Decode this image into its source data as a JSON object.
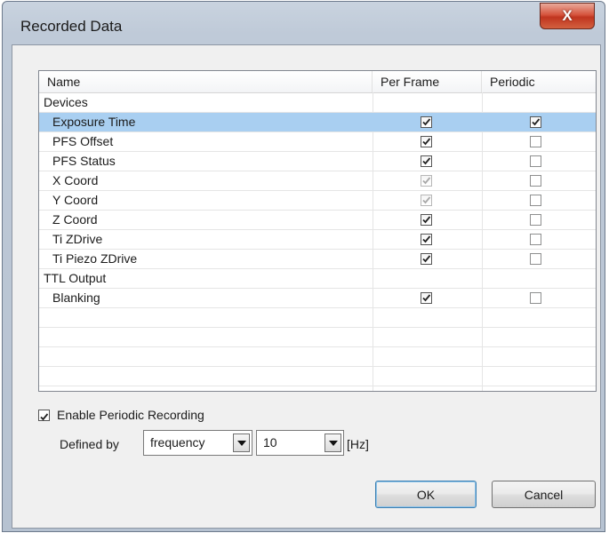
{
  "window": {
    "title": "Recorded Data",
    "close_label": "X"
  },
  "table": {
    "columns": [
      "Name",
      "Per Frame",
      "Periodic"
    ],
    "rows": [
      {
        "name": "Devices",
        "indent": 0,
        "group": true
      },
      {
        "name": "Exposure Time",
        "indent": 1,
        "per_frame": "checked",
        "periodic": "checked",
        "selected": true
      },
      {
        "name": "PFS Offset",
        "indent": 1,
        "per_frame": "checked",
        "periodic": "unchecked"
      },
      {
        "name": "PFS Status",
        "indent": 1,
        "per_frame": "checked",
        "periodic": "unchecked"
      },
      {
        "name": "X Coord",
        "indent": 1,
        "per_frame": "checked-disabled",
        "periodic": "unchecked"
      },
      {
        "name": "Y Coord",
        "indent": 1,
        "per_frame": "checked-disabled",
        "periodic": "unchecked"
      },
      {
        "name": "Z Coord",
        "indent": 1,
        "per_frame": "checked",
        "periodic": "unchecked"
      },
      {
        "name": "Ti ZDrive",
        "indent": 1,
        "per_frame": "checked",
        "periodic": "unchecked"
      },
      {
        "name": "Ti Piezo ZDrive",
        "indent": 1,
        "per_frame": "checked",
        "periodic": "unchecked"
      },
      {
        "name": "TTL Output",
        "indent": 0,
        "group": true
      },
      {
        "name": "Blanking",
        "indent": 1,
        "per_frame": "checked",
        "periodic": "unchecked"
      },
      {
        "name": "",
        "indent": 0,
        "group": true
      },
      {
        "name": "",
        "indent": 0,
        "group": true
      },
      {
        "name": "",
        "indent": 0,
        "group": true
      },
      {
        "name": "",
        "indent": 0,
        "group": true
      }
    ]
  },
  "periodic": {
    "enable_label": "Enable Periodic Recording",
    "enabled": true,
    "defined_by_label": "Defined by",
    "mode_value": "frequency",
    "rate_value": "10",
    "unit": "[Hz]"
  },
  "buttons": {
    "ok": "OK",
    "cancel": "Cancel"
  },
  "colors": {
    "selection": "#a9cff1",
    "close_button": "#c8432b"
  }
}
